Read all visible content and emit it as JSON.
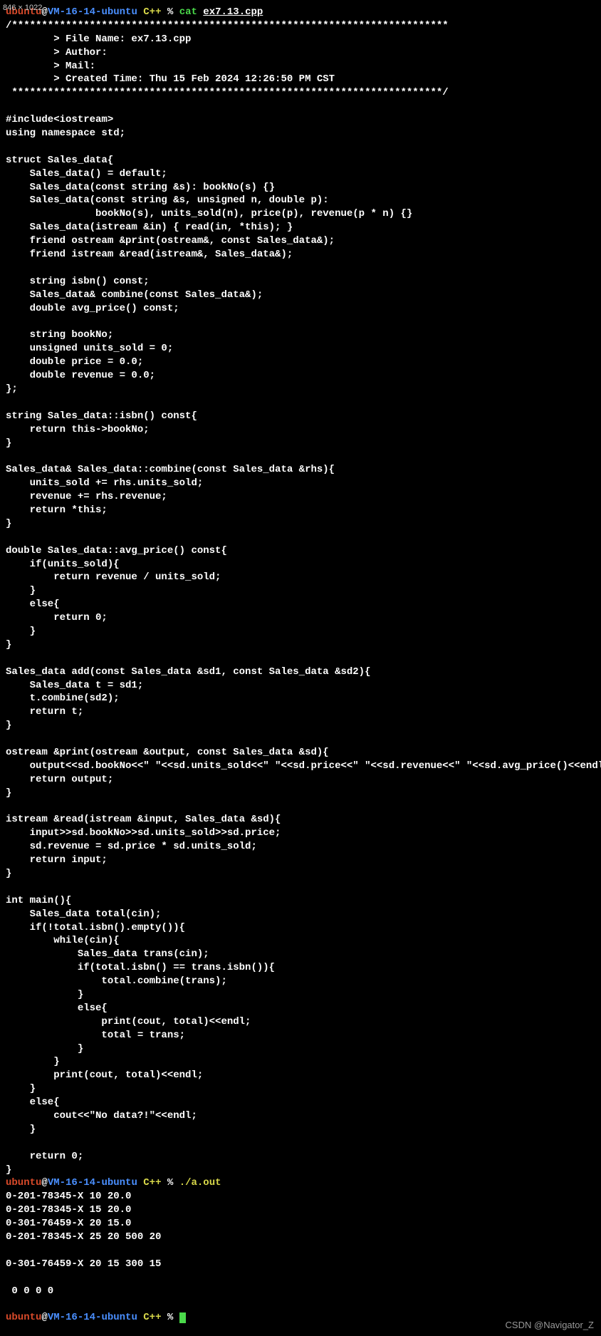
{
  "dimensions": "846 × 1022",
  "prompt1": {
    "user": "ubuntu",
    "at": "@",
    "host": "VM-16-14-ubuntu",
    "path": " C++",
    "sym": " % ",
    "cmd": "cat ",
    "arg": "ex7.13.cpp"
  },
  "code": [
    "/*************************************************************************",
    "        > File Name: ex7.13.cpp",
    "        > Author:",
    "        > Mail:",
    "        > Created Time: Thu 15 Feb 2024 12:26:50 PM CST",
    " ************************************************************************/",
    "",
    "#include<iostream>",
    "using namespace std;",
    "",
    "struct Sales_data{",
    "    Sales_data() = default;",
    "    Sales_data(const string &s): bookNo(s) {}",
    "    Sales_data(const string &s, unsigned n, double p):",
    "               bookNo(s), units_sold(n), price(p), revenue(p * n) {}",
    "    Sales_data(istream &in) { read(in, *this); }",
    "    friend ostream &print(ostream&, const Sales_data&);",
    "    friend istream &read(istream&, Sales_data&);",
    "",
    "    string isbn() const;",
    "    Sales_data& combine(const Sales_data&);",
    "    double avg_price() const;",
    "",
    "    string bookNo;",
    "    unsigned units_sold = 0;",
    "    double price = 0.0;",
    "    double revenue = 0.0;",
    "};",
    "",
    "string Sales_data::isbn() const{",
    "    return this->bookNo;",
    "}",
    "",
    "Sales_data& Sales_data::combine(const Sales_data &rhs){",
    "    units_sold += rhs.units_sold;",
    "    revenue += rhs.revenue;",
    "    return *this;",
    "}",
    "",
    "double Sales_data::avg_price() const{",
    "    if(units_sold){",
    "        return revenue / units_sold;",
    "    }",
    "    else{",
    "        return 0;",
    "    }",
    "}",
    "",
    "Sales_data add(const Sales_data &sd1, const Sales_data &sd2){",
    "    Sales_data t = sd1;",
    "    t.combine(sd2);",
    "    return t;",
    "}",
    "",
    "ostream &print(ostream &output, const Sales_data &sd){",
    "    output<<sd.bookNo<<\" \"<<sd.units_sold<<\" \"<<sd.price<<\" \"<<sd.revenue<<\" \"<<sd.avg_price()<<endl;",
    "    return output;",
    "}",
    "",
    "istream &read(istream &input, Sales_data &sd){",
    "    input>>sd.bookNo>>sd.units_sold>>sd.price;",
    "    sd.revenue = sd.price * sd.units_sold;",
    "    return input;",
    "}",
    "",
    "int main(){",
    "    Sales_data total(cin);",
    "    if(!total.isbn().empty()){",
    "        while(cin){",
    "            Sales_data trans(cin);",
    "            if(total.isbn() == trans.isbn()){",
    "                total.combine(trans);",
    "            }",
    "            else{",
    "                print(cout, total)<<endl;",
    "                total = trans;",
    "            }",
    "        }",
    "        print(cout, total)<<endl;",
    "    }",
    "    else{",
    "        cout<<\"No data?!\"<<endl;",
    "    }",
    "",
    "    return 0;",
    "}"
  ],
  "prompt2": {
    "user": "ubuntu",
    "at": "@",
    "host": "VM-16-14-ubuntu",
    "path": " C++",
    "sym": " % ",
    "exe": "./a.out"
  },
  "output": [
    "0-201-78345-X 10 20.0",
    "0-201-78345-X 15 20.0",
    "0-301-76459-X 20 15.0",
    "0-201-78345-X 25 20 500 20",
    "",
    "0-301-76459-X 20 15 300 15",
    "",
    " 0 0 0 0"
  ],
  "prompt3": {
    "user": "ubuntu",
    "at": "@",
    "host": "VM-16-14-ubuntu",
    "path": " C++",
    "sym": " % "
  },
  "watermark": "CSDN @Navigator_Z"
}
